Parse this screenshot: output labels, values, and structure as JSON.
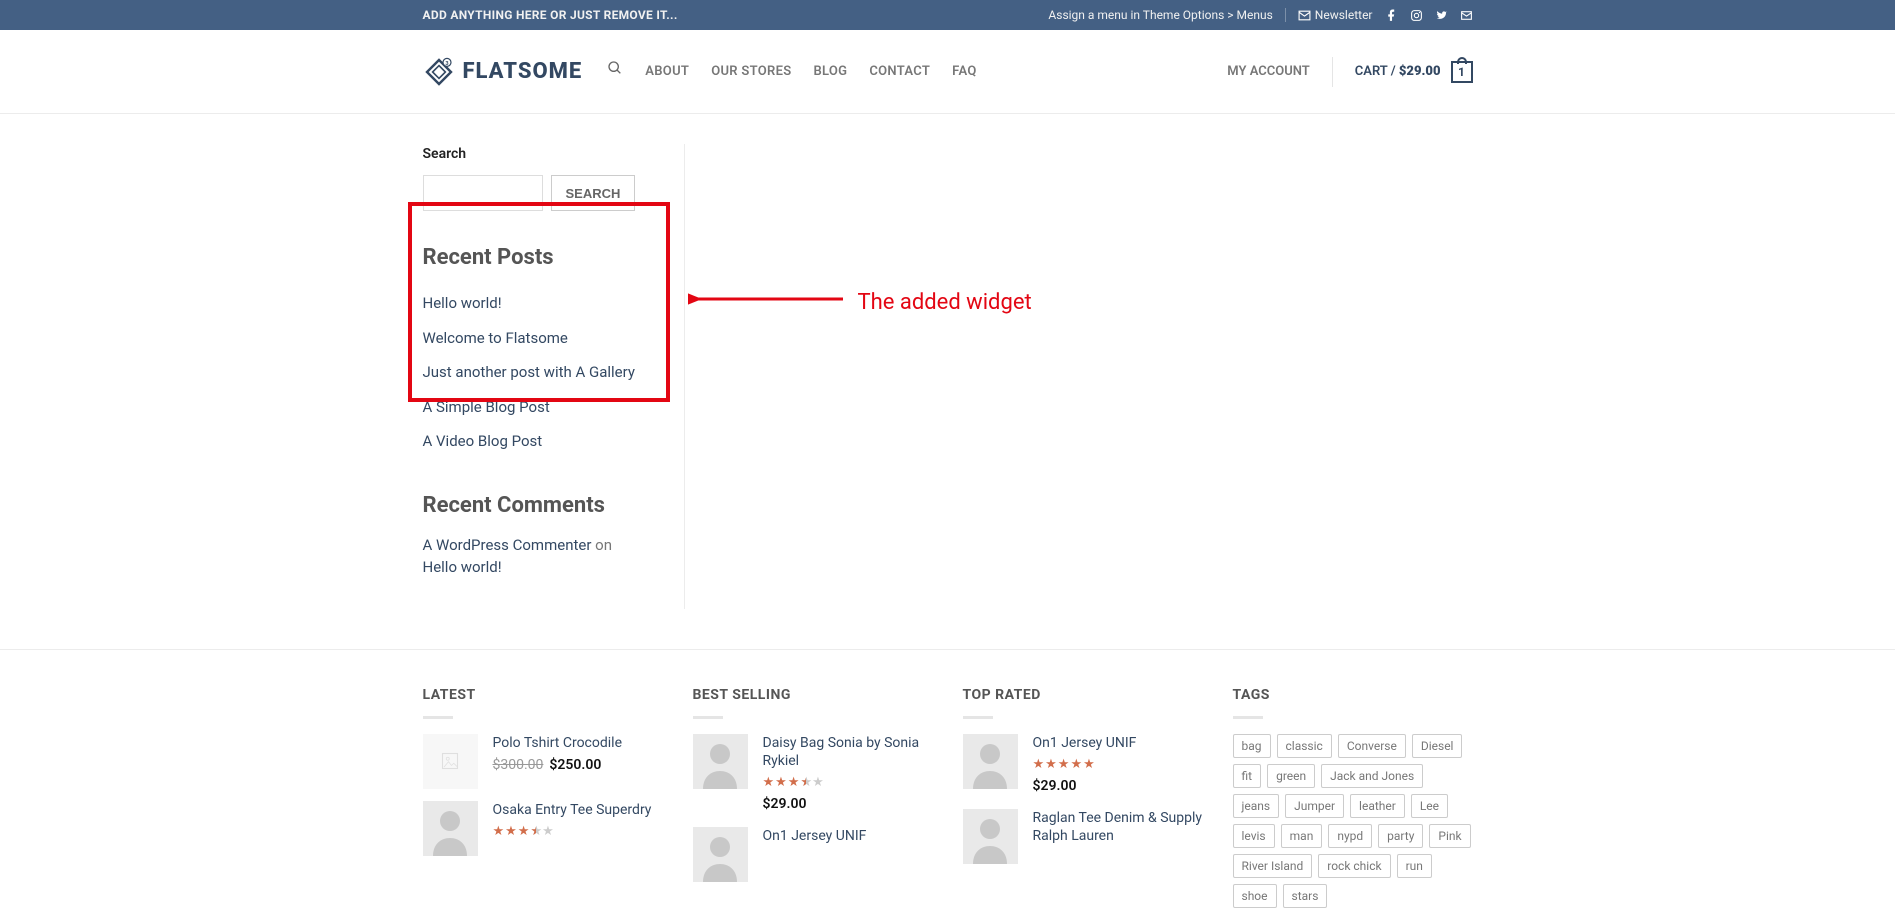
{
  "topbar": {
    "left_text": "ADD ANYTHING HERE OR JUST REMOVE IT...",
    "menu_hint": "Assign a menu in Theme Options > Menus",
    "newsletter": "Newsletter"
  },
  "header": {
    "logo_text": "FLATSOME",
    "nav": [
      "ABOUT",
      "OUR STORES",
      "BLOG",
      "CONTACT",
      "FAQ"
    ],
    "account": "MY ACCOUNT",
    "cart_label": "CART / ",
    "cart_price": "$29.00",
    "cart_count": "1"
  },
  "sidebar": {
    "search_label": "Search",
    "search_button": "SEARCH",
    "recent_posts_title": "Recent Posts",
    "posts": [
      "Hello world!",
      "Welcome to Flatsome",
      "Just another post with A Gallery",
      "A Simple Blog Post",
      "A Video Blog Post"
    ],
    "recent_comments_title": "Recent Comments",
    "comment_author": "A WordPress Commenter",
    "comment_on": " on ",
    "comment_post": "Hello world!"
  },
  "annotation": {
    "text": "The added widget"
  },
  "footer": {
    "latest": {
      "title": "LATEST",
      "items": [
        {
          "title": "Polo Tshirt Crocodile",
          "old_price": "$300.00",
          "price": "$250.00",
          "thumb": "placeholder"
        },
        {
          "title": "Osaka Entry Tee Superdry",
          "thumb": "avatar",
          "stars": 3.5
        }
      ]
    },
    "best_selling": {
      "title": "BEST SELLING",
      "items": [
        {
          "title": "Daisy Bag Sonia by Sonia Rykiel",
          "price": "$29.00",
          "thumb": "avatar",
          "stars": 3.5
        },
        {
          "title": "On1 Jersey UNIF",
          "thumb": "avatar"
        }
      ]
    },
    "top_rated": {
      "title": "TOP RATED",
      "items": [
        {
          "title": "On1 Jersey UNIF",
          "price": "$29.00",
          "thumb": "avatar",
          "stars": 5
        },
        {
          "title": "Raglan Tee Denim & Supply Ralph Lauren",
          "thumb": "avatar"
        }
      ]
    },
    "tags": {
      "title": "TAGS",
      "items": [
        "bag",
        "classic",
        "Converse",
        "Diesel",
        "fit",
        "green",
        "Jack and Jones",
        "jeans",
        "Jumper",
        "leather",
        "Lee",
        "levis",
        "man",
        "nypd",
        "party",
        "Pink",
        "River Island",
        "rock chick",
        "run",
        "shoe",
        "stars"
      ]
    }
  }
}
